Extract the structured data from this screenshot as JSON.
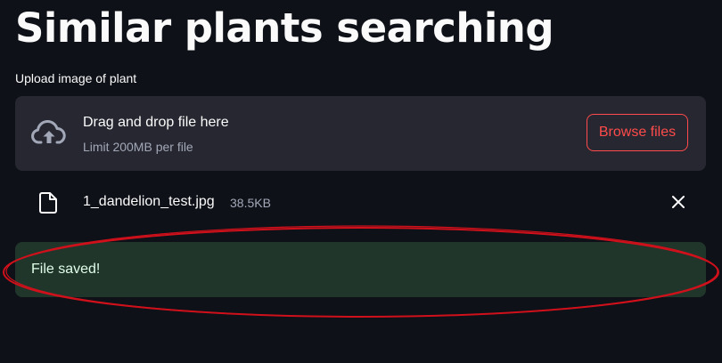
{
  "header": {
    "title": "Similar plants searching"
  },
  "uploader": {
    "label": "Upload image of plant",
    "drag_text": "Drag and drop file here",
    "limit_text": "Limit 200MB per file",
    "browse_label": "Browse files",
    "cloud_icon": "cloud-upload-icon"
  },
  "uploaded_file": {
    "name": "1_dandelion_test.jpg",
    "size": "38.5KB",
    "file_icon": "file-icon",
    "remove_icon": "close-icon"
  },
  "alert": {
    "message": "File saved!",
    "type": "success"
  },
  "colors": {
    "background": "#0e1117",
    "accent": "#ff4b4b",
    "dropzone": "#262730",
    "success_bg": "#21362b",
    "success_text": "#dffde9",
    "annotation": "#d0101b"
  }
}
